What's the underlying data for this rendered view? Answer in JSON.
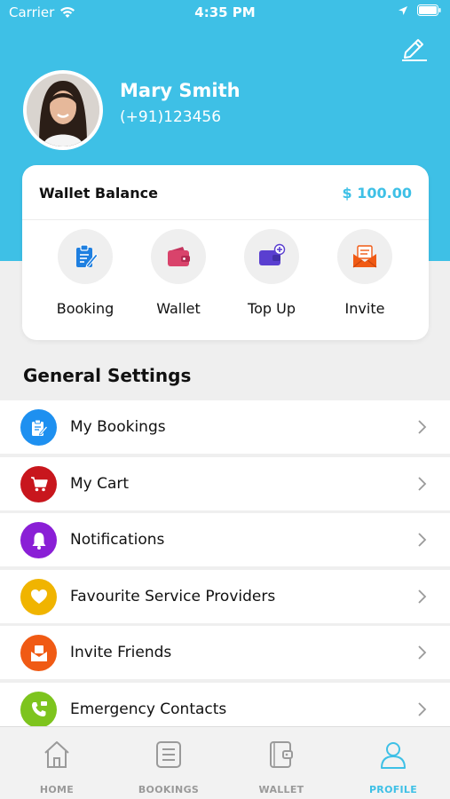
{
  "status_bar": {
    "carrier": "Carrier",
    "time": "4:35 PM"
  },
  "profile": {
    "name": "Mary Smith",
    "phone": "(+91)123456"
  },
  "wallet": {
    "label": "Wallet Balance",
    "amount": "$ 100.00",
    "actions": [
      {
        "label": "Booking",
        "icon": "clipboard-icon"
      },
      {
        "label": "Wallet",
        "icon": "wallet-icon"
      },
      {
        "label": "Top Up",
        "icon": "card-add-icon"
      },
      {
        "label": "Invite",
        "icon": "envelope-icon"
      }
    ]
  },
  "settings": {
    "title": "General Settings",
    "items": [
      {
        "label": "My Bookings",
        "icon": "clipboard-icon",
        "color": "#1e90f0"
      },
      {
        "label": "My Cart",
        "icon": "cart-icon",
        "color": "#c8161d"
      },
      {
        "label": "Notifications",
        "icon": "bell-icon",
        "color": "#8a1fd6"
      },
      {
        "label": "Favourite Service Providers",
        "icon": "heart-icon",
        "color": "#f0b400"
      },
      {
        "label": "Invite Friends",
        "icon": "envelope-icon",
        "color": "#f05a14"
      },
      {
        "label": "Emergency Contacts",
        "icon": "phone-icon",
        "color": "#7dc41e"
      }
    ]
  },
  "tabs": [
    {
      "label": "HOME",
      "icon": "home-icon",
      "active": false
    },
    {
      "label": "BOOKINGS",
      "icon": "list-icon",
      "active": false
    },
    {
      "label": "WALLET",
      "icon": "wallet-icon",
      "active": false
    },
    {
      "label": "PROFILE",
      "icon": "person-icon",
      "active": true
    }
  ],
  "colors": {
    "accent": "#3ec0e6",
    "background": "#efefef"
  }
}
